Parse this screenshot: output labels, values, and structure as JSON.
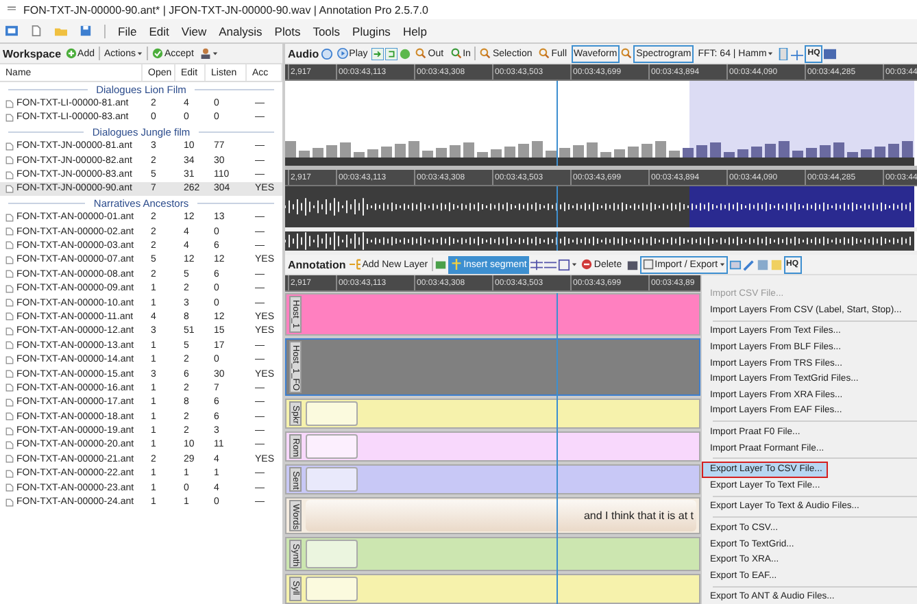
{
  "window": {
    "title": "FON-TXT-JN-00000-90.ant* | JFON-TXT-JN-00000-90.wav | Annotation Pro 2.5.7.0"
  },
  "menu_bar": {
    "items": [
      "File",
      "Edit",
      "View",
      "Analysis",
      "Plots",
      "Tools",
      "Plugins",
      "Help"
    ]
  },
  "workspace": {
    "toolbar": {
      "title": "Workspace",
      "add": "Add",
      "actions": "Actions",
      "accept": "Accept"
    },
    "columns": [
      "Name",
      "Open",
      "Edit",
      "Listen",
      "Acc"
    ],
    "groups": [
      {
        "name": "Dialogues Lion Film",
        "rows": [
          {
            "cells": [
              "FON-TXT-LI-00000-81.ant",
              "2",
              "4",
              "0",
              "—"
            ],
            "selected": false
          },
          {
            "cells": [
              "FON-TXT-LI-00000-83.ant",
              "0",
              "0",
              "0",
              "—"
            ],
            "selected": false
          }
        ]
      },
      {
        "name": "Dialogues Jungle film",
        "rows": [
          {
            "cells": [
              "FON-TXT-JN-00000-81.ant",
              "3",
              "10",
              "77",
              "—"
            ],
            "selected": false
          },
          {
            "cells": [
              "FON-TXT-JN-00000-82.ant",
              "2",
              "34",
              "30",
              "—"
            ],
            "selected": false
          },
          {
            "cells": [
              "FON-TXT-JN-00000-83.ant",
              "5",
              "31",
              "110",
              "—"
            ],
            "selected": false
          },
          {
            "cells": [
              "FON-TXT-JN-00000-90.ant",
              "7",
              "262",
              "304",
              "YES"
            ],
            "selected": true
          }
        ]
      },
      {
        "name": "Narratives Ancestors",
        "rows": [
          {
            "cells": [
              "FON-TXT-AN-00000-01.ant",
              "2",
              "12",
              "13",
              "—"
            ],
            "selected": false
          },
          {
            "cells": [
              "FON-TXT-AN-00000-02.ant",
              "2",
              "4",
              "0",
              "—"
            ],
            "selected": false
          },
          {
            "cells": [
              "FON-TXT-AN-00000-03.ant",
              "2",
              "4",
              "6",
              "—"
            ],
            "selected": false
          },
          {
            "cells": [
              "FON-TXT-AN-00000-07.ant",
              "5",
              "12",
              "12",
              "YES"
            ],
            "selected": false
          },
          {
            "cells": [
              "FON-TXT-AN-00000-08.ant",
              "2",
              "5",
              "6",
              "—"
            ],
            "selected": false
          },
          {
            "cells": [
              "FON-TXT-AN-00000-09.ant",
              "1",
              "2",
              "0",
              "—"
            ],
            "selected": false
          },
          {
            "cells": [
              "FON-TXT-AN-00000-10.ant",
              "1",
              "3",
              "0",
              "—"
            ],
            "selected": false
          },
          {
            "cells": [
              "FON-TXT-AN-00000-11.ant",
              "4",
              "8",
              "12",
              "YES"
            ],
            "selected": false
          },
          {
            "cells": [
              "FON-TXT-AN-00000-12.ant",
              "3",
              "51",
              "15",
              "YES"
            ],
            "selected": false
          },
          {
            "cells": [
              "FON-TXT-AN-00000-13.ant",
              "1",
              "5",
              "17",
              "—"
            ],
            "selected": false
          },
          {
            "cells": [
              "FON-TXT-AN-00000-14.ant",
              "1",
              "2",
              "0",
              "—"
            ],
            "selected": false
          },
          {
            "cells": [
              "FON-TXT-AN-00000-15.ant",
              "3",
              "6",
              "30",
              "YES"
            ],
            "selected": false
          },
          {
            "cells": [
              "FON-TXT-AN-00000-16.ant",
              "1",
              "2",
              "7",
              "—"
            ],
            "selected": false
          },
          {
            "cells": [
              "FON-TXT-AN-00000-17.ant",
              "1",
              "8",
              "6",
              "—"
            ],
            "selected": false
          },
          {
            "cells": [
              "FON-TXT-AN-00000-18.ant",
              "1",
              "2",
              "6",
              "—"
            ],
            "selected": false
          },
          {
            "cells": [
              "FON-TXT-AN-00000-19.ant",
              "1",
              "2",
              "3",
              "—"
            ],
            "selected": false
          },
          {
            "cells": [
              "FON-TXT-AN-00000-20.ant",
              "1",
              "10",
              "11",
              "—"
            ],
            "selected": false
          },
          {
            "cells": [
              "FON-TXT-AN-00000-21.ant",
              "2",
              "29",
              "4",
              "YES"
            ],
            "selected": false
          },
          {
            "cells": [
              "FON-TXT-AN-00000-22.ant",
              "1",
              "1",
              "1",
              "—"
            ],
            "selected": false
          },
          {
            "cells": [
              "FON-TXT-AN-00000-23.ant",
              "1",
              "0",
              "4",
              "—"
            ],
            "selected": false
          },
          {
            "cells": [
              "FON-TXT-AN-00000-24.ant",
              "1",
              "1",
              "0",
              "—"
            ],
            "selected": false
          }
        ]
      }
    ]
  },
  "audio": {
    "toolbar": {
      "title": "Audio",
      "play": "Play",
      "zoom_out": "Out",
      "zoom_in": "In",
      "selection": "Selection",
      "full": "Full",
      "fft": "FFT: 64 | Hamm",
      "hq": "HQ"
    },
    "view_toggles": [
      {
        "label": "Waveform",
        "on": true
      },
      {
        "label": "Spectrogram",
        "on": true
      }
    ],
    "spectrogram_ruler": [
      "2,917",
      "00:03:43,113",
      "00:03:43,308",
      "00:03:43,503",
      "00:03:43,699",
      "00:03:43,894",
      "00:03:44,090",
      "00:03:44,285",
      "00:03:44"
    ],
    "waveform_ruler": [
      "2,917",
      "00:03:43,113",
      "00:03:43,308",
      "00:03:43,503",
      "00:03:43,699",
      "00:03:43,894",
      "00:03:44,090",
      "00:03:44,285",
      "00:03:44"
    ]
  },
  "annotation": {
    "toolbar": {
      "title": "Annotation",
      "add_layer": "Add New Layer",
      "insert_segment": "Insert segment",
      "insert_selected": true,
      "delete": "Delete",
      "import_export": "Import / Export",
      "hq": "HQ"
    },
    "ruler": [
      "2,917",
      "00:03:43,113",
      "00:03:43,308",
      "00:03:43,503",
      "00:03:43,699",
      "00:03:43,89"
    ],
    "layers": [
      {
        "name": "Host_1",
        "color": "#ff80c0",
        "selected": false,
        "kind": "plain"
      },
      {
        "name": "Host_1_FO",
        "color": "#808080",
        "selected": true,
        "kind": "plain"
      },
      {
        "name": "Spkr",
        "color": "#f6f2ac",
        "selected": false,
        "kind": "segmented"
      },
      {
        "name": "Rom",
        "color": "#f8d8fc",
        "selected": false,
        "kind": "segmented"
      },
      {
        "name": "Sent",
        "color": "#c8c8f6",
        "selected": false,
        "kind": "segmented"
      },
      {
        "name": "Words",
        "color": "#f5ece0",
        "selected": false,
        "kind": "text",
        "text": "and I think that it is at t"
      },
      {
        "name": "Synth",
        "color": "#cce6b0",
        "selected": false,
        "kind": "segmented"
      },
      {
        "name": "Syll",
        "color": "#f6f2ac",
        "selected": false,
        "kind": "segmented"
      }
    ]
  },
  "context_menu": {
    "items": [
      {
        "kind": "item",
        "label": "Import CSV File...",
        "disabled": true,
        "selected": false
      },
      {
        "kind": "item",
        "label": "Import Layers From CSV (Label, Start, Stop)...",
        "disabled": false,
        "selected": false
      },
      {
        "kind": "separator"
      },
      {
        "kind": "item",
        "label": "Import Layers From Text Files...",
        "disabled": false,
        "selected": false
      },
      {
        "kind": "item",
        "label": "Import Layers From BLF Files...",
        "disabled": false,
        "selected": false
      },
      {
        "kind": "item",
        "label": "Import Layers From TRS Files...",
        "disabled": false,
        "selected": false
      },
      {
        "kind": "item",
        "label": "Import Layers From TextGrid Files...",
        "disabled": false,
        "selected": false
      },
      {
        "kind": "item",
        "label": "Import Layers From XRA Files...",
        "disabled": false,
        "selected": false
      },
      {
        "kind": "item",
        "label": "Import Layers From EAF Files...",
        "disabled": false,
        "selected": false
      },
      {
        "kind": "separator"
      },
      {
        "kind": "item",
        "label": "Import Praat F0 File...",
        "disabled": false,
        "selected": false
      },
      {
        "kind": "item",
        "label": "Import Praat Formant File...",
        "disabled": false,
        "selected": false
      },
      {
        "kind": "separator"
      },
      {
        "kind": "item",
        "label": "Export Layer To CSV File...",
        "disabled": false,
        "selected": true
      },
      {
        "kind": "item",
        "label": "Export Layer To Text File...",
        "disabled": false,
        "selected": false
      },
      {
        "kind": "separator"
      },
      {
        "kind": "item",
        "label": "Export Layer To Text & Audio Files...",
        "disabled": false,
        "selected": false
      },
      {
        "kind": "separator"
      },
      {
        "kind": "item",
        "label": "Export To CSV...",
        "disabled": false,
        "selected": false
      },
      {
        "kind": "item",
        "label": "Export To TextGrid...",
        "disabled": false,
        "selected": false
      },
      {
        "kind": "item",
        "label": "Export To XRA...",
        "disabled": false,
        "selected": false
      },
      {
        "kind": "item",
        "label": "Export To EAF...",
        "disabled": false,
        "selected": false
      },
      {
        "kind": "separator"
      },
      {
        "kind": "item",
        "label": "Export To ANT & Audio Files...",
        "disabled": false,
        "selected": false
      }
    ]
  }
}
